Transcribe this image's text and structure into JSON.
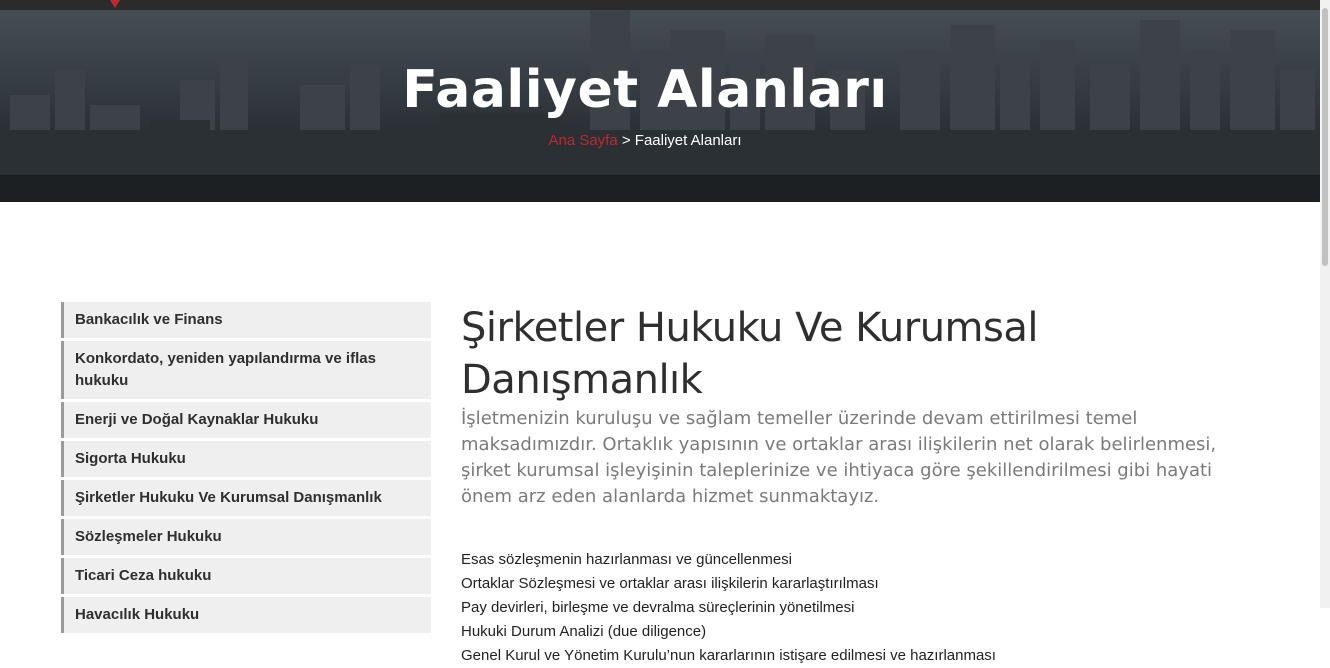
{
  "hero": {
    "title": "Faaliyet Alanları",
    "breadcrumb_home": "Ana Sayfa",
    "breadcrumb_sep": " > ",
    "breadcrumb_current": "Faaliyet Alanları"
  },
  "sidebar": {
    "items": [
      {
        "label": "Bankacılık ve Finans"
      },
      {
        "label": "Konkordato, yeniden yapılandırma ve iflas hukuku"
      },
      {
        "label": "Enerji ve Doğal Kaynaklar Hukuku"
      },
      {
        "label": "Sigorta Hukuku"
      },
      {
        "label": "Şirketler Hukuku Ve Kurumsal Danışmanlık"
      },
      {
        "label": "Sözleşmeler Hukuku"
      },
      {
        "label": "Ticari Ceza hukuku"
      },
      {
        "label": "Havacılık Hukuku"
      }
    ]
  },
  "content": {
    "title": "Şirketler Hukuku Ve Kurumsal Danışmanlık",
    "lead": "İşletmenizin kuruluşu ve sağlam temeller üzerinde devam ettirilmesi temel maksadımızdır. Ortaklık yapısının ve ortaklar arası ilişkilerin net olarak belirlenmesi, şirket kurumsal işleyişinin taleplerinize ve ihtiyaca göre şekillendirilmesi gibi hayati önem arz eden alanlarda hizmet sunmaktayız.",
    "bullets": [
      "Esas sözleşmenin hazırlanması ve güncellenmesi",
      "Ortaklar Sözleşmesi ve ortaklar arası ilişkilerin kararlaştırılması",
      "Pay devirleri, birleşme ve devralma süreçlerinin yönetilmesi",
      "Hukuki Durum Analizi (due diligence)",
      "Genel Kurul ve Yönetim Kurulu’nun kararlarının istişare edilmesi ve hazırlanması"
    ]
  },
  "colors": {
    "accent": "#c0282d",
    "sidebar_bg": "#efefef",
    "topbar": "#2b2b2b"
  }
}
